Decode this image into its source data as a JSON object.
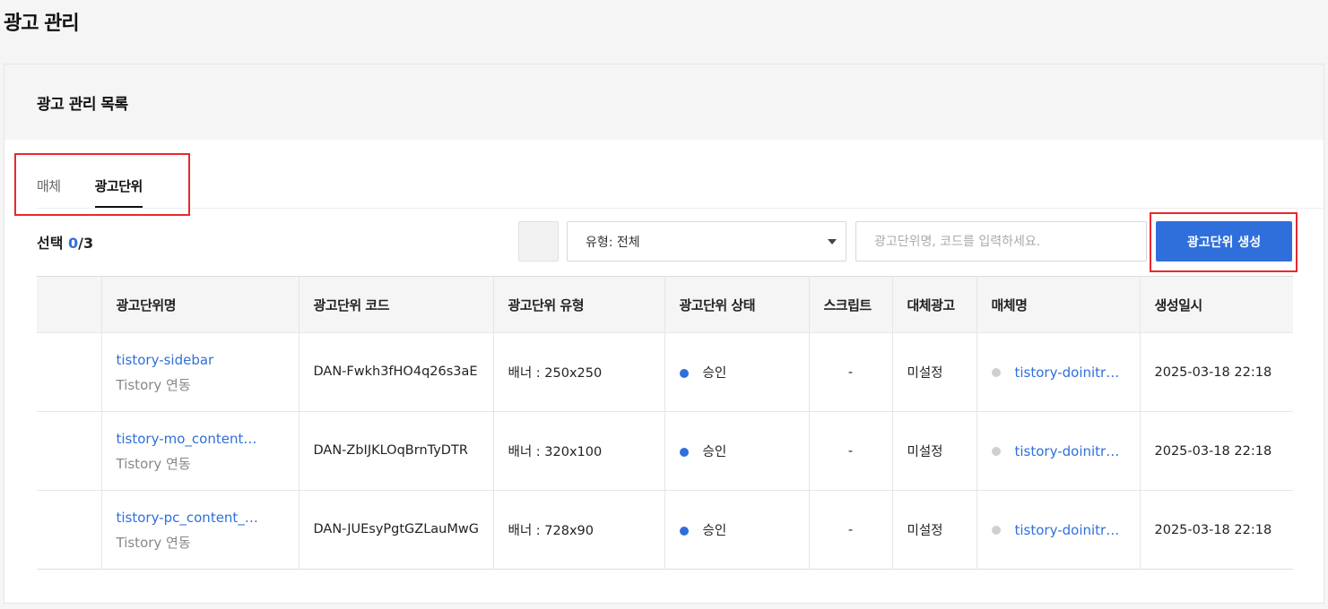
{
  "page": {
    "title": "광고 관리"
  },
  "card": {
    "title": "광고 관리 목록"
  },
  "tabs": [
    {
      "label": "매체",
      "active": false
    },
    {
      "label": "광고단위",
      "active": true
    }
  ],
  "toolbar": {
    "selection_label": "선택",
    "selected_count": "0",
    "total_count": "/3",
    "type_select_value": "유형: 전체",
    "search_placeholder": "광고단위명, 코드를 입력하세요.",
    "create_button_label": "광고단위 생성"
  },
  "table": {
    "headers": [
      "광고단위명",
      "광고단위 코드",
      "광고단위 유형",
      "광고단위 상태",
      "스크립트",
      "대체광고",
      "매체명",
      "생성일시"
    ],
    "rows": [
      {
        "name": "tistory-sidebar",
        "source": "Tistory 연동",
        "code": "DAN-Fwkh3fHO4q26s3aE",
        "type": "배너 : 250x250",
        "status": "승인",
        "script": "-",
        "fallback": "미설정",
        "media": "tistory-doinitr…",
        "created": "2025-03-18 22:18"
      },
      {
        "name": "tistory-mo_content…",
        "source": "Tistory 연동",
        "code": "DAN-ZbIJKLOqBrnTyDTR",
        "type": "배너 : 320x100",
        "status": "승인",
        "script": "-",
        "fallback": "미설정",
        "media": "tistory-doinitr…",
        "created": "2025-03-18 22:18"
      },
      {
        "name": "tistory-pc_content_…",
        "source": "Tistory 연동",
        "code": "DAN-JUEsyPgtGZLauMwG",
        "type": "배너 : 728x90",
        "status": "승인",
        "script": "-",
        "fallback": "미설정",
        "media": "tistory-doinitr…",
        "created": "2025-03-18 22:18"
      }
    ]
  },
  "colors": {
    "accent": "#2f6fdc",
    "highlight": "#e8282d",
    "status_approved": "#2f6fdc",
    "media_dot": "#cfcfcf"
  }
}
